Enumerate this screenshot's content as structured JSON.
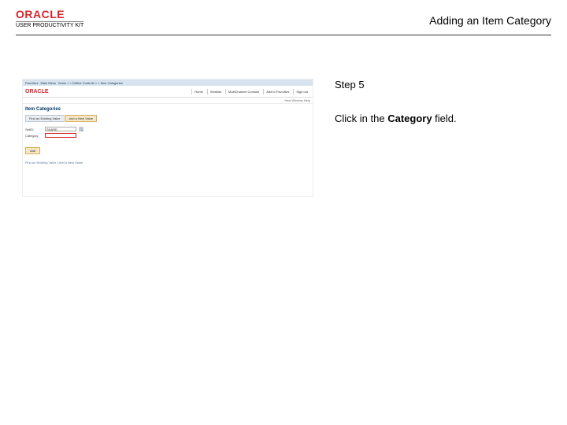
{
  "header": {
    "brand": "ORACLE",
    "sub_brand": "USER PRODUCTIVITY KIT",
    "page_title": "Adding an Item Category"
  },
  "instructions": {
    "step_label": "Step 5",
    "text_prefix": "Click in the ",
    "text_bold": "Category",
    "text_suffix": " field."
  },
  "screenshot": {
    "breadcrumb": {
      "a": "Favorites",
      "b": "Main Menu",
      "c": "Items > > Define Controls > > Item Categories"
    },
    "brand": "ORACLE",
    "nav": {
      "home": "Home",
      "worklist": "Worklist",
      "mcfc": "MultiChannel Console",
      "add": "Add to Favorites",
      "signout": "Sign out"
    },
    "subrow": "New Window  Help",
    "section_title": "Item Categories",
    "tabs": {
      "find": "Find an Existing Value",
      "add": "Add a New Value"
    },
    "form": {
      "setid_label": "SetID:",
      "setid_value": "SHARE",
      "category_label": "Category:",
      "category_value": ""
    },
    "add_btn": "Add",
    "footer": "Find an Existing Value | Add a New Value"
  }
}
